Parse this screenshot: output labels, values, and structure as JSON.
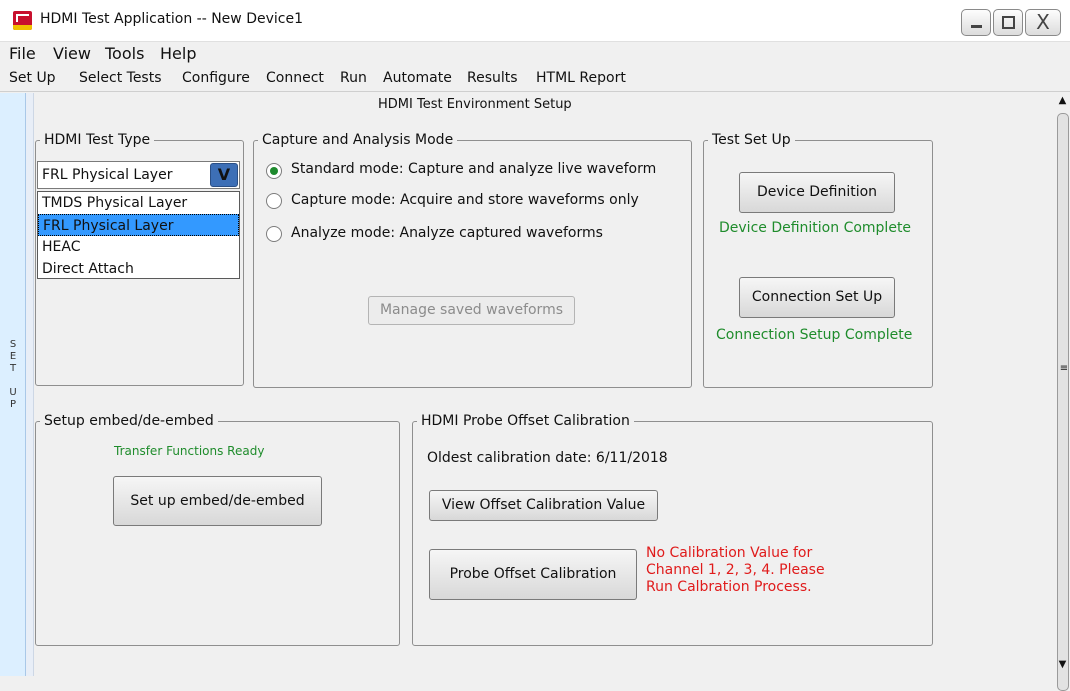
{
  "window": {
    "title": "HDMI Test Application -- New Device1",
    "minimize_glyph": "",
    "maximize_glyph": "",
    "close_glyph": "X"
  },
  "menubar": [
    "File",
    "View",
    "Tools",
    "Help"
  ],
  "toolbar": [
    "Set Up",
    "Select Tests",
    "Configure",
    "Connect",
    "Run",
    "Automate",
    "Results",
    "HTML Report"
  ],
  "side_tab": {
    "letters": [
      "S",
      "E",
      "T",
      "",
      "U",
      "P"
    ]
  },
  "page_title": "HDMI Test Environment Setup",
  "test_type": {
    "legend": "HDMI Test Type",
    "selected": "FRL Physical Layer",
    "options": [
      "TMDS Physical Layer",
      "FRL Physical Layer",
      "HEAC",
      "Direct Attach"
    ],
    "chevron_glyph": "V"
  },
  "capture_mode": {
    "legend": "Capture and Analysis Mode",
    "options": [
      {
        "label": "Standard mode: Capture and analyze live waveform",
        "checked": true
      },
      {
        "label": "Capture mode: Acquire and store waveforms only",
        "checked": false
      },
      {
        "label": "Analyze mode: Analyze captured waveforms",
        "checked": false
      }
    ],
    "manage_button": "Manage saved waveforms"
  },
  "test_setup": {
    "legend": "Test Set Up",
    "device_button": "Device Definition",
    "device_status": "Device Definition Complete",
    "connection_button": "Connection Set Up",
    "connection_status": "Connection Setup Complete"
  },
  "embed": {
    "legend": "Setup embed/de-embed",
    "status": "Transfer Functions Ready",
    "button": "Set up embed/de-embed"
  },
  "probe": {
    "legend": "HDMI Probe Offset Calibration",
    "oldest_date": "Oldest calibration date: 6/11/2018",
    "view_button": "View Offset Calibration Value",
    "calibrate_button": "Probe Offset Calibration",
    "warning_lines": [
      "No Calibration Value for",
      "Channel 1, 2, 3, 4. Please",
      "Run Calbration Process."
    ]
  },
  "scrollbar": {
    "up_glyph": "▲",
    "grip_glyph": "≡",
    "down_glyph": "▼"
  },
  "colors": {
    "status_green": "#1f8c2c",
    "warning_red": "#e01b1b",
    "selection_blue": "#3399ff",
    "radio_checked": "#1e8a2e"
  }
}
